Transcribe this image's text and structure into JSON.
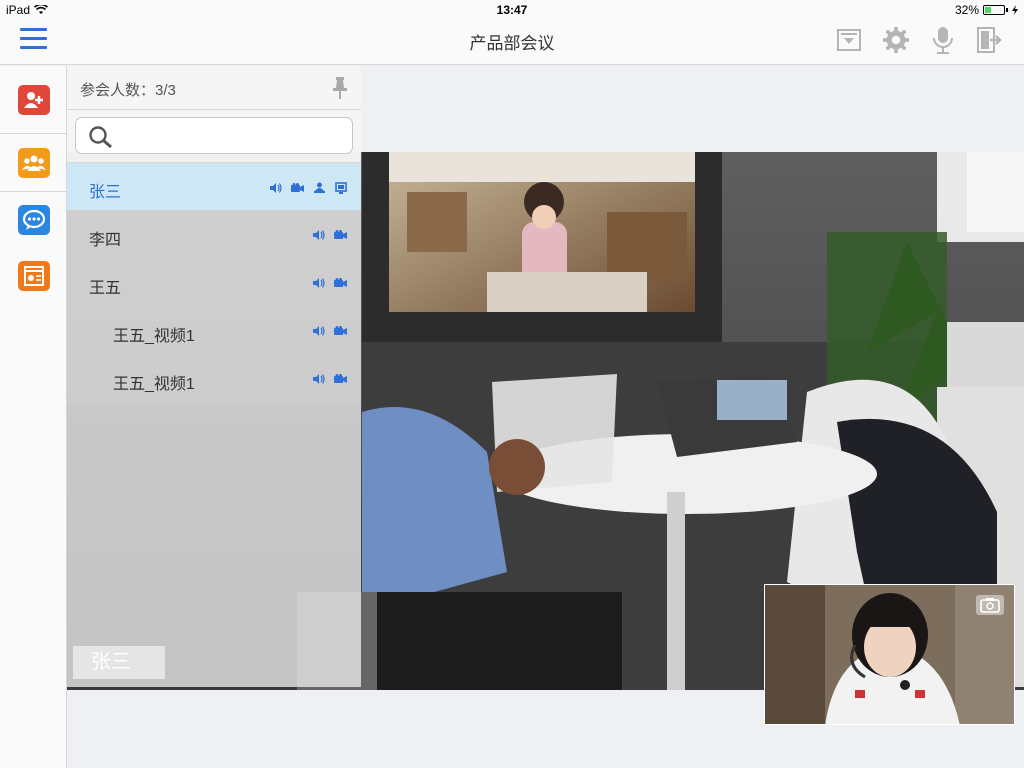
{
  "status": {
    "device": "iPad",
    "time": "13:47",
    "battery": "32%"
  },
  "header": {
    "title": "产品部会议"
  },
  "panel": {
    "count_label": "参会人数：3/3",
    "search": {
      "value": "",
      "placeholder": ""
    },
    "participants": [
      {
        "name": "张三",
        "active": true,
        "icons": [
          "speaker-icon",
          "camera-icon",
          "presenter-icon",
          "screen-share-icon"
        ]
      },
      {
        "name": "李四",
        "active": false,
        "icons": [
          "speaker-icon",
          "camera-icon"
        ]
      },
      {
        "name": "王五",
        "active": false,
        "icons": [
          "speaker-icon",
          "camera-icon"
        ]
      },
      {
        "name": "王五_视频1",
        "active": false,
        "sub": true,
        "icons": [
          "speaker-icon",
          "camera-icon"
        ]
      },
      {
        "name": "王五_视频1",
        "active": false,
        "sub": true,
        "icons": [
          "speaker-icon",
          "camera-icon"
        ]
      }
    ]
  },
  "video": {
    "speaker_name": "张三"
  },
  "colors": {
    "accent": "#2f6fd8",
    "rail_red": "#e0463a",
    "rail_orange": "#f29a1a",
    "rail_blue": "#2a86e0"
  }
}
